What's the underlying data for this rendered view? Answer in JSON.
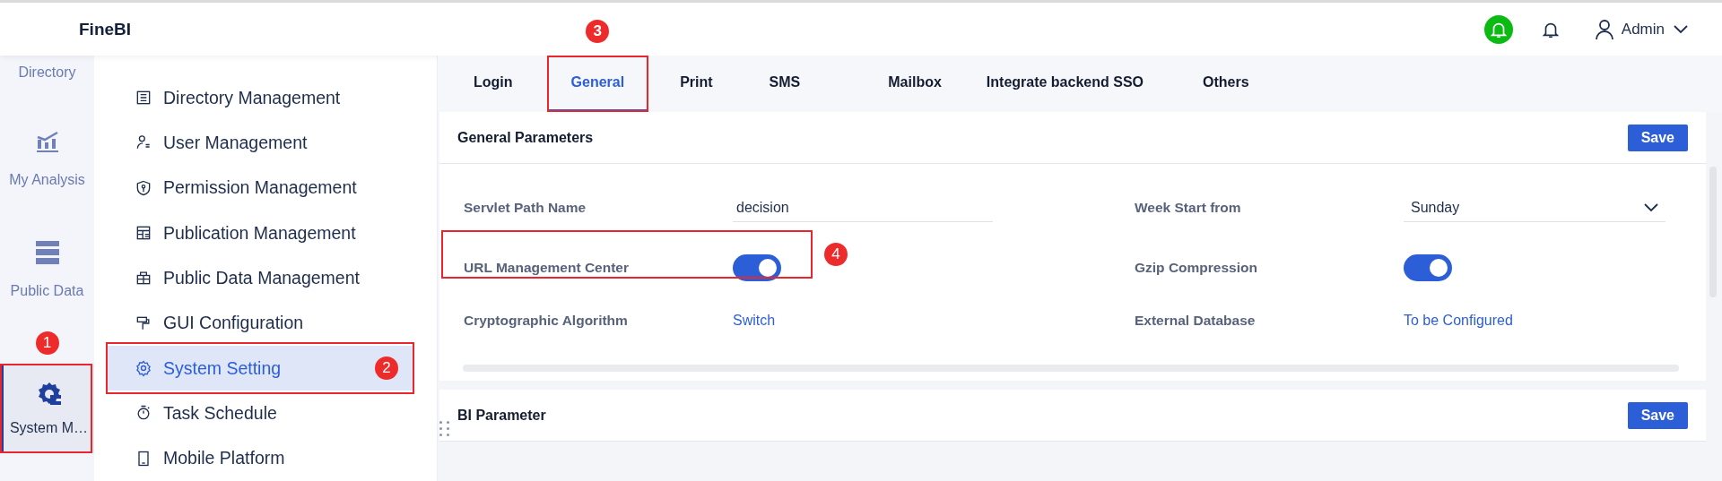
{
  "header": {
    "logo": "FineBI",
    "user": "Admin"
  },
  "rail": [
    {
      "label": "Directory",
      "selected": false
    },
    {
      "label": "My Analysis",
      "selected": false
    },
    {
      "label": "Public Data",
      "selected": false
    },
    {
      "label": "System M…",
      "selected": true,
      "callout": "1"
    }
  ],
  "submenu": [
    {
      "label": "Directory Management",
      "selected": false
    },
    {
      "label": "User Management",
      "selected": false
    },
    {
      "label": "Permission Management",
      "selected": false
    },
    {
      "label": "Publication Management",
      "selected": false
    },
    {
      "label": "Public Data Management",
      "selected": false
    },
    {
      "label": "GUI Configuration",
      "selected": false
    },
    {
      "label": "System Setting",
      "selected": true,
      "callout": "2"
    },
    {
      "label": "Task Schedule",
      "selected": false
    },
    {
      "label": "Mobile Platform",
      "selected": false
    }
  ],
  "tabs": [
    {
      "label": "Login",
      "selected": false
    },
    {
      "label": "General",
      "selected": true,
      "callout": "3"
    },
    {
      "label": "Print",
      "selected": false
    },
    {
      "label": "SMS",
      "selected": false
    },
    {
      "label": "Mailbox",
      "selected": false
    },
    {
      "label": "Integrate backend SSO",
      "selected": false
    },
    {
      "label": "Others",
      "selected": false
    }
  ],
  "general_parameters": {
    "title": "General Parameters",
    "save": "Save",
    "rows": [
      [
        {
          "label": "Servlet Path Name",
          "kind": "input",
          "value": "decision"
        },
        {
          "label": "Week Start from",
          "kind": "select",
          "value": "Sunday"
        }
      ],
      [
        {
          "label": "URL Management Center",
          "kind": "toggle",
          "on": true,
          "callout": "4"
        },
        {
          "label": "Gzip Compression",
          "kind": "toggle",
          "on": true
        }
      ],
      [
        {
          "label": "Cryptographic Algorithm",
          "kind": "link",
          "value": "Switch"
        },
        {
          "label": "External Database",
          "kind": "link",
          "value": "To be Configured"
        }
      ]
    ]
  },
  "bi_parameter": {
    "title": "BI Parameter",
    "save": "Save"
  }
}
